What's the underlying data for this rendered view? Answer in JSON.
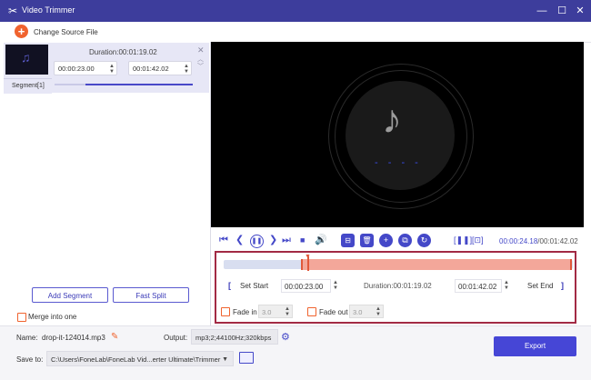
{
  "window": {
    "title": "Video Trimmer",
    "minimize": "—",
    "maximize": "☐",
    "close": "✕"
  },
  "top": {
    "change_source_label": "Change Source File"
  },
  "segment": {
    "duration": "Duration:00:01:19.02",
    "start": "00:00:23.00",
    "end": "00:01:42.02",
    "tab_label": "Segment[1]"
  },
  "left_buttons": {
    "add_segment": "Add Segment",
    "fast_split": "Fast Split",
    "merge": "Merge into one"
  },
  "player": {
    "current_time": "00:00:24.18",
    "total_time": "/00:01:42.02"
  },
  "trim": {
    "set_start": "Set Start",
    "start_value": "00:00:23.00",
    "duration": "Duration:00:01:19.02",
    "end_value": "00:01:42.02",
    "set_end": "Set End",
    "fade_in_label": "Fade in",
    "fade_in_value": "3.0",
    "fade_out_label": "Fade out",
    "fade_out_value": "3.0"
  },
  "bottom": {
    "name_label": "Name:",
    "name_value": "drop-it-124014.mp3",
    "output_label": "Output:",
    "output_value": "mp3;2;44100Hz;320kbps",
    "save_label": "Save to:",
    "save_value": "C:\\Users\\FoneLab\\FoneLab Vid...erter Ultimate\\Trimmer",
    "export_label": "Export"
  },
  "colors": {
    "titlebar": "#3d3d9c",
    "accent": "#4448c8",
    "orange": "#f0632e",
    "highlight_border": "#a22a44"
  }
}
